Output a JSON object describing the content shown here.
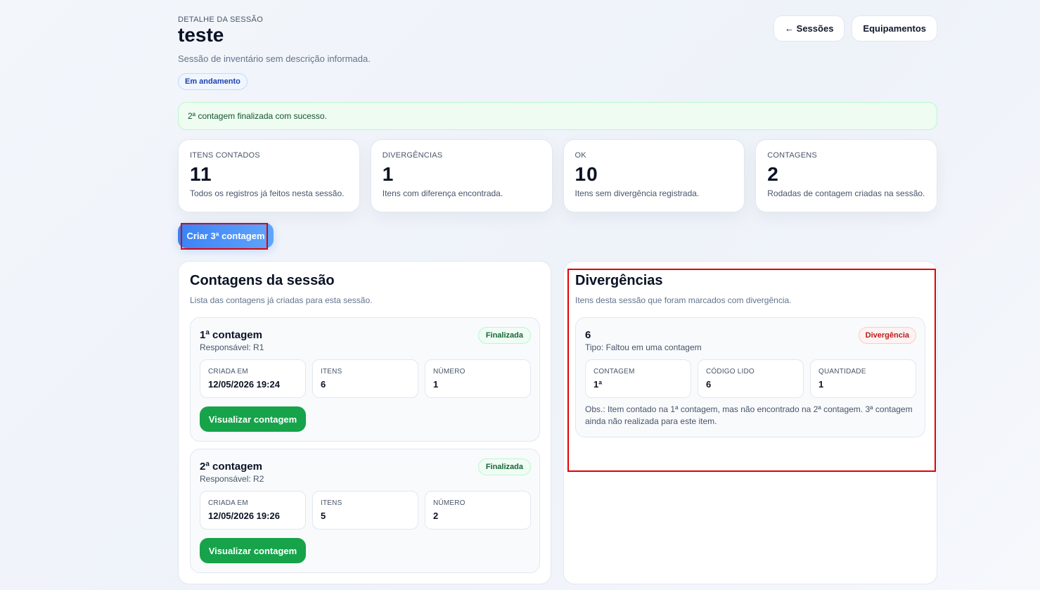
{
  "header": {
    "eyebrow": "DETALHE DA SESSÃO",
    "title": "teste",
    "description": "Sessão de inventário sem descrição informada.",
    "status": "Em andamento",
    "back_button": "← Sessões",
    "equipment_button": "Equipamentos"
  },
  "alert": {
    "message": "2ª contagem finalizada com sucesso."
  },
  "stats": [
    {
      "label": "ITENS CONTADOS",
      "value": "11",
      "note": "Todos os registros já feitos nesta sessão."
    },
    {
      "label": "DIVERGÊNCIAS",
      "value": "1",
      "note": "Itens com diferença encontrada."
    },
    {
      "label": "OK",
      "value": "10",
      "note": "Itens sem divergência registrada."
    },
    {
      "label": "CONTAGENS",
      "value": "2",
      "note": "Rodadas de contagem criadas na sessão."
    }
  ],
  "create_button": "Criar 3ª contagem",
  "counts_panel": {
    "title": "Contagens da sessão",
    "subtitle": "Lista das contagens já criadas para esta sessão.",
    "items": [
      {
        "title": "1ª contagem",
        "responsible": "Responsável: R1",
        "status": "Finalizada",
        "created_label": "CRIADA EM",
        "created_value": "12/05/2026 19:24",
        "items_label": "ITENS",
        "items_value": "6",
        "number_label": "NÚMERO",
        "number_value": "1",
        "view_button": "Visualizar contagem"
      },
      {
        "title": "2ª contagem",
        "responsible": "Responsável: R2",
        "status": "Finalizada",
        "created_label": "CRIADA EM",
        "created_value": "12/05/2026 19:26",
        "items_label": "ITENS",
        "items_value": "5",
        "number_label": "NÚMERO",
        "number_value": "2",
        "view_button": "Visualizar contagem"
      }
    ]
  },
  "divergences_panel": {
    "title": "Divergências",
    "subtitle": "Itens desta sessão que foram marcados com divergência.",
    "items": [
      {
        "code": "6",
        "type": "Tipo: Faltou em uma contagem",
        "badge": "Divergência",
        "count_label": "CONTAGEM",
        "count_value": "1ª",
        "code_label": "CÓDIGO LIDO",
        "code_value": "6",
        "qty_label": "QUANTIDADE",
        "qty_value": "1",
        "obs": "Obs.: Item contado na 1ª contagem, mas não encontrado na 2ª contagem. 3ª contagem ainda não realizada para este item."
      }
    ]
  },
  "colors": {
    "primary": "#3b82f6",
    "success": "#16a34a",
    "danger": "#b91c1c",
    "highlight": "#e00000"
  }
}
